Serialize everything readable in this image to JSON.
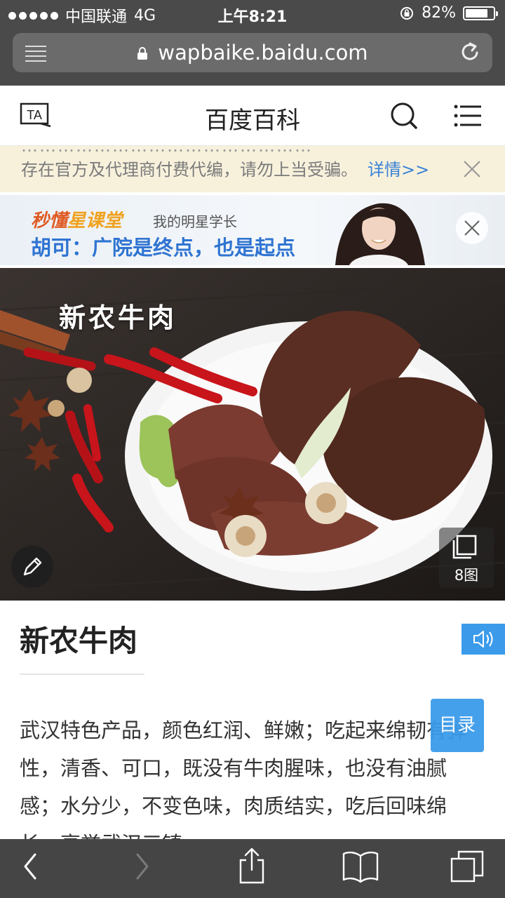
{
  "status_bar": {
    "carrier": "中国联通",
    "network": "4G",
    "time": "上午8:21",
    "battery_percent": "82%",
    "battery_level": 0.82
  },
  "browser": {
    "url": "wapbaike.baidu.com"
  },
  "header": {
    "title": "百度百科",
    "logo_text": "TA"
  },
  "notice": {
    "cut_line": "…………………………………………",
    "text": "存在官方及代理商付费代编，请勿上当受骗。",
    "more_link": "详情>>"
  },
  "ad": {
    "brand_part1": "秒懂",
    "brand_part2": "星课堂",
    "subtitle": "我的明星学长",
    "slogan": "胡可：广院是终点，也是起点"
  },
  "hero": {
    "caption": "新农牛肉",
    "gallery_count": "8图"
  },
  "entry": {
    "title": "新农牛肉",
    "paragraph": "武汉特色产品，颜色红润、鲜嫩；吃起来绵韧有弹性，清香、可口，既没有牛肉腥味，也没有油腻感；水分少，不变色味，肉质结实，吃后回味绵长，享誉武汉三镇。",
    "toc_label": "目录"
  },
  "icons": {
    "menu": "menu-icon",
    "lock": "lock-icon",
    "reload": "reload-icon",
    "search": "search-icon",
    "list": "list-icon",
    "close": "close-icon",
    "edit": "pencil-icon",
    "gallery": "gallery-icon",
    "speaker": "speaker-icon",
    "back": "back-icon",
    "forward": "forward-icon",
    "share": "share-icon",
    "bookmarks": "book-icon",
    "tabs": "tabs-icon"
  },
  "colors": {
    "accent_blue": "#3b9bea",
    "link_blue": "#3a82d6",
    "notice_bg": "#f7f1dc",
    "chrome_gray": "#4a4a4a"
  }
}
